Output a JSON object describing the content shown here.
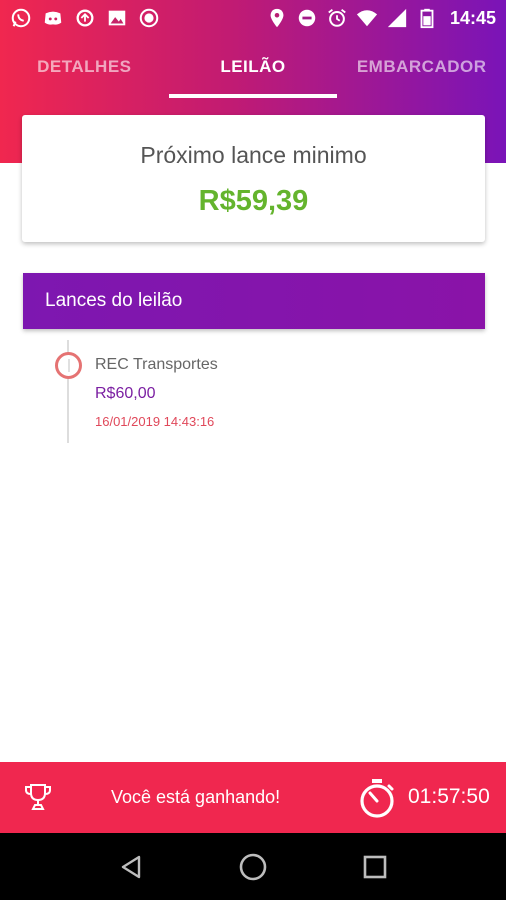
{
  "status_bar": {
    "time": "14:45",
    "left_icons": [
      "whatsapp-icon",
      "discord-icon",
      "sync-icon",
      "image-icon",
      "record-icon"
    ],
    "right_icons": [
      "location-icon",
      "do-not-disturb-icon",
      "alarm-icon",
      "wifi-icon",
      "signal-icon",
      "battery-icon"
    ]
  },
  "tabs": [
    {
      "label": "DETALHES",
      "active": false
    },
    {
      "label": "LEILÃO",
      "active": true
    },
    {
      "label": "EMBARCADOR",
      "active": false
    }
  ],
  "next_bid": {
    "title": "Próximo lance minimo",
    "value": "R$59,39"
  },
  "bids_section": {
    "title": "Lances do leilão",
    "entries": [
      {
        "company": "REC Transportes",
        "amount": "R$60,00",
        "date": "16/01/2019 14:43:16"
      }
    ]
  },
  "bottom_bar": {
    "status": "Você está ganhando!",
    "timer": "01:57:50"
  },
  "colors": {
    "brand_red": "#f0274f",
    "brand_purple": "#7a14b8",
    "price_green": "#64b42d",
    "bid_purple": "#7b1fa2",
    "date_red": "#e0485a"
  }
}
